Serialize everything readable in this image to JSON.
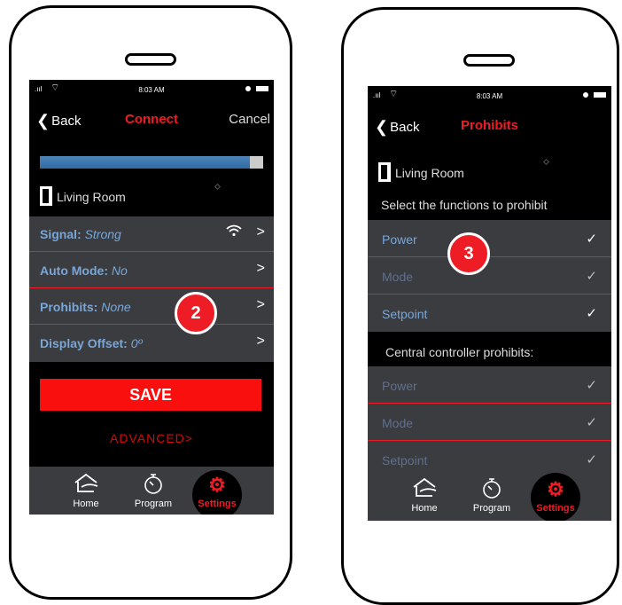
{
  "left_phone": {
    "status": {
      "time": "8:03 AM"
    },
    "nav": {
      "back": "Back",
      "title": "Connect",
      "cancel": "Cancel"
    },
    "progress": 0.94,
    "room": "Living Room",
    "settings": [
      {
        "label": "Signal:",
        "value": "Strong",
        "icon": "wifi-icon"
      },
      {
        "label": "Auto Mode:",
        "value": "No"
      },
      {
        "label": "Prohibits:",
        "value": "None"
      },
      {
        "label": "Display Offset:",
        "value": "0º"
      }
    ],
    "badge": "2",
    "save": "SAVE",
    "advanced": "ADVANCED",
    "tabs": {
      "home": "Home",
      "program": "Program",
      "settings": "Settings"
    }
  },
  "right_phone": {
    "status": {
      "time": "8:03 AM"
    },
    "nav": {
      "back": "Back",
      "title": "Prohibits"
    },
    "room": "Living Room",
    "select_heading": "Select the functions to prohibit",
    "prohibits": [
      {
        "label": "Power",
        "checked": true
      },
      {
        "label": "Mode",
        "checked": true
      },
      {
        "label": "Setpoint",
        "checked": true
      }
    ],
    "badge": "3",
    "central_heading": "Central controller prohibits:",
    "central": [
      {
        "label": "Power",
        "checked": true
      },
      {
        "label": "Mode",
        "checked": true
      },
      {
        "label": "Setpoint",
        "checked": true
      }
    ],
    "tabs": {
      "home": "Home",
      "program": "Program",
      "settings": "Settings"
    }
  },
  "colors": {
    "accent": "#ee1c25",
    "link": "#7aa6d6",
    "panel": "#3a3c40"
  }
}
